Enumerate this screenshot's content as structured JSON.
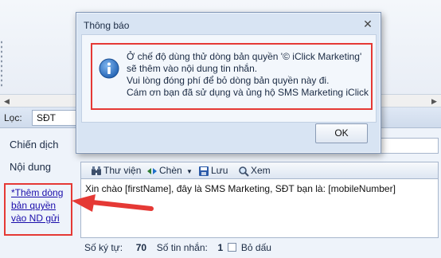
{
  "filter": {
    "label": "Lọc:",
    "value": "SĐT"
  },
  "form": {
    "campaign_label": "Chiến dịch",
    "content_label": "Nội dung",
    "toolbar": {
      "library": "Thư viện",
      "insert": "Chèn",
      "save": "Lưu",
      "view": "Xem"
    },
    "message_text": "Xin chào [firstName], đây là SMS Marketing, SĐT bạn là: [mobileNumber]",
    "add_copyright_link": "*Thêm dòng bản quyền vào ND gửi",
    "status": {
      "char_count_label": "Số ký tự:",
      "char_count": "70",
      "msg_count_label": "Số tin nhắn:",
      "msg_count": "1",
      "no_accent_label": "Bỏ dấu"
    }
  },
  "dialog": {
    "title": "Thông báo",
    "lines": [
      "Ở chế độ dùng thử dòng bản quyền '© iClick Marketing'",
      "sẽ thêm vào nội dung tin nhắn.",
      "Vui lòng đóng phí để bỏ dòng bản quyền này đi.",
      "Cám ơn bạn đã sử dụng và ủng hộ SMS Marketing iClick"
    ],
    "ok_label": "OK",
    "close_icon": "close-icon",
    "info_icon": "info-icon"
  },
  "colors": {
    "highlight": "#e53935",
    "link": "#1a0dab",
    "info_blue": "#1f6fc9"
  }
}
